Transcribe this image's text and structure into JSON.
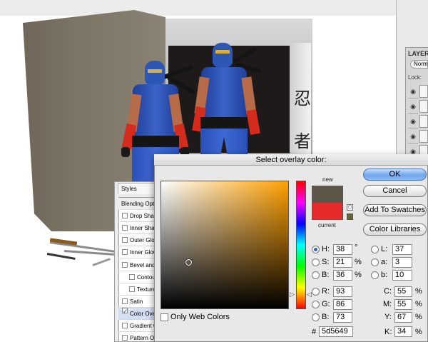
{
  "dialog": {
    "title": "Select overlay color:",
    "buttons": {
      "ok": "OK",
      "cancel": "Cancel",
      "add_to_swatches": "Add To Swatches",
      "color_libraries": "Color Libraries"
    },
    "swatch": {
      "new_label": "new",
      "current_label": "current",
      "new_color": "#5d5649",
      "current_color": "#e52b2b",
      "websafe_color": "#666633"
    },
    "only_web_colors": "Only Web Colors",
    "hsb": {
      "h": {
        "label": "H:",
        "value": "38",
        "unit": "°"
      },
      "s": {
        "label": "S:",
        "value": "21",
        "unit": "%"
      },
      "b": {
        "label": "B:",
        "value": "36",
        "unit": "%"
      }
    },
    "rgb": {
      "r": {
        "label": "R:",
        "value": "93"
      },
      "g": {
        "label": "G:",
        "value": "86"
      },
      "b": {
        "label": "B:",
        "value": "73"
      }
    },
    "lab": {
      "l": {
        "label": "L:",
        "value": "37"
      },
      "a": {
        "label": "a:",
        "value": "3"
      },
      "b": {
        "label": "b:",
        "value": "10"
      }
    },
    "cmyk": {
      "c": {
        "label": "C:",
        "value": "55",
        "unit": "%"
      },
      "m": {
        "label": "M:",
        "value": "55",
        "unit": "%"
      },
      "y": {
        "label": "Y:",
        "value": "67",
        "unit": "%"
      },
      "k": {
        "label": "K:",
        "value": "34",
        "unit": "%"
      }
    },
    "hex": {
      "label": "#",
      "value": "5d5649"
    },
    "hue_color": "#ff9f00"
  },
  "styles_panel": {
    "title": "Styles",
    "items": [
      {
        "label": "Blending Options",
        "checkbox": false
      },
      {
        "label": "Drop Shadow",
        "checkbox": true
      },
      {
        "label": "Inner Shadow",
        "checkbox": true
      },
      {
        "label": "Outer Glow",
        "checkbox": true
      },
      {
        "label": "Inner Glow",
        "checkbox": true
      },
      {
        "label": "Bevel and Emboss",
        "checkbox": true
      },
      {
        "label": "Contour",
        "checkbox": true
      },
      {
        "label": "Texture",
        "checkbox": true
      },
      {
        "label": "Satin",
        "checkbox": true
      },
      {
        "label": "Color Overlay",
        "checkbox": true
      },
      {
        "label": "Gradient Overlay",
        "checkbox": true
      },
      {
        "label": "Pattern Overlay",
        "checkbox": true
      }
    ]
  },
  "layers_panel": {
    "title": "LAYERS",
    "blend_mode": "Norma",
    "lock_label": "Lock:"
  },
  "canvas": {
    "kanji_top": "忍",
    "kanji_bottom": "者"
  }
}
